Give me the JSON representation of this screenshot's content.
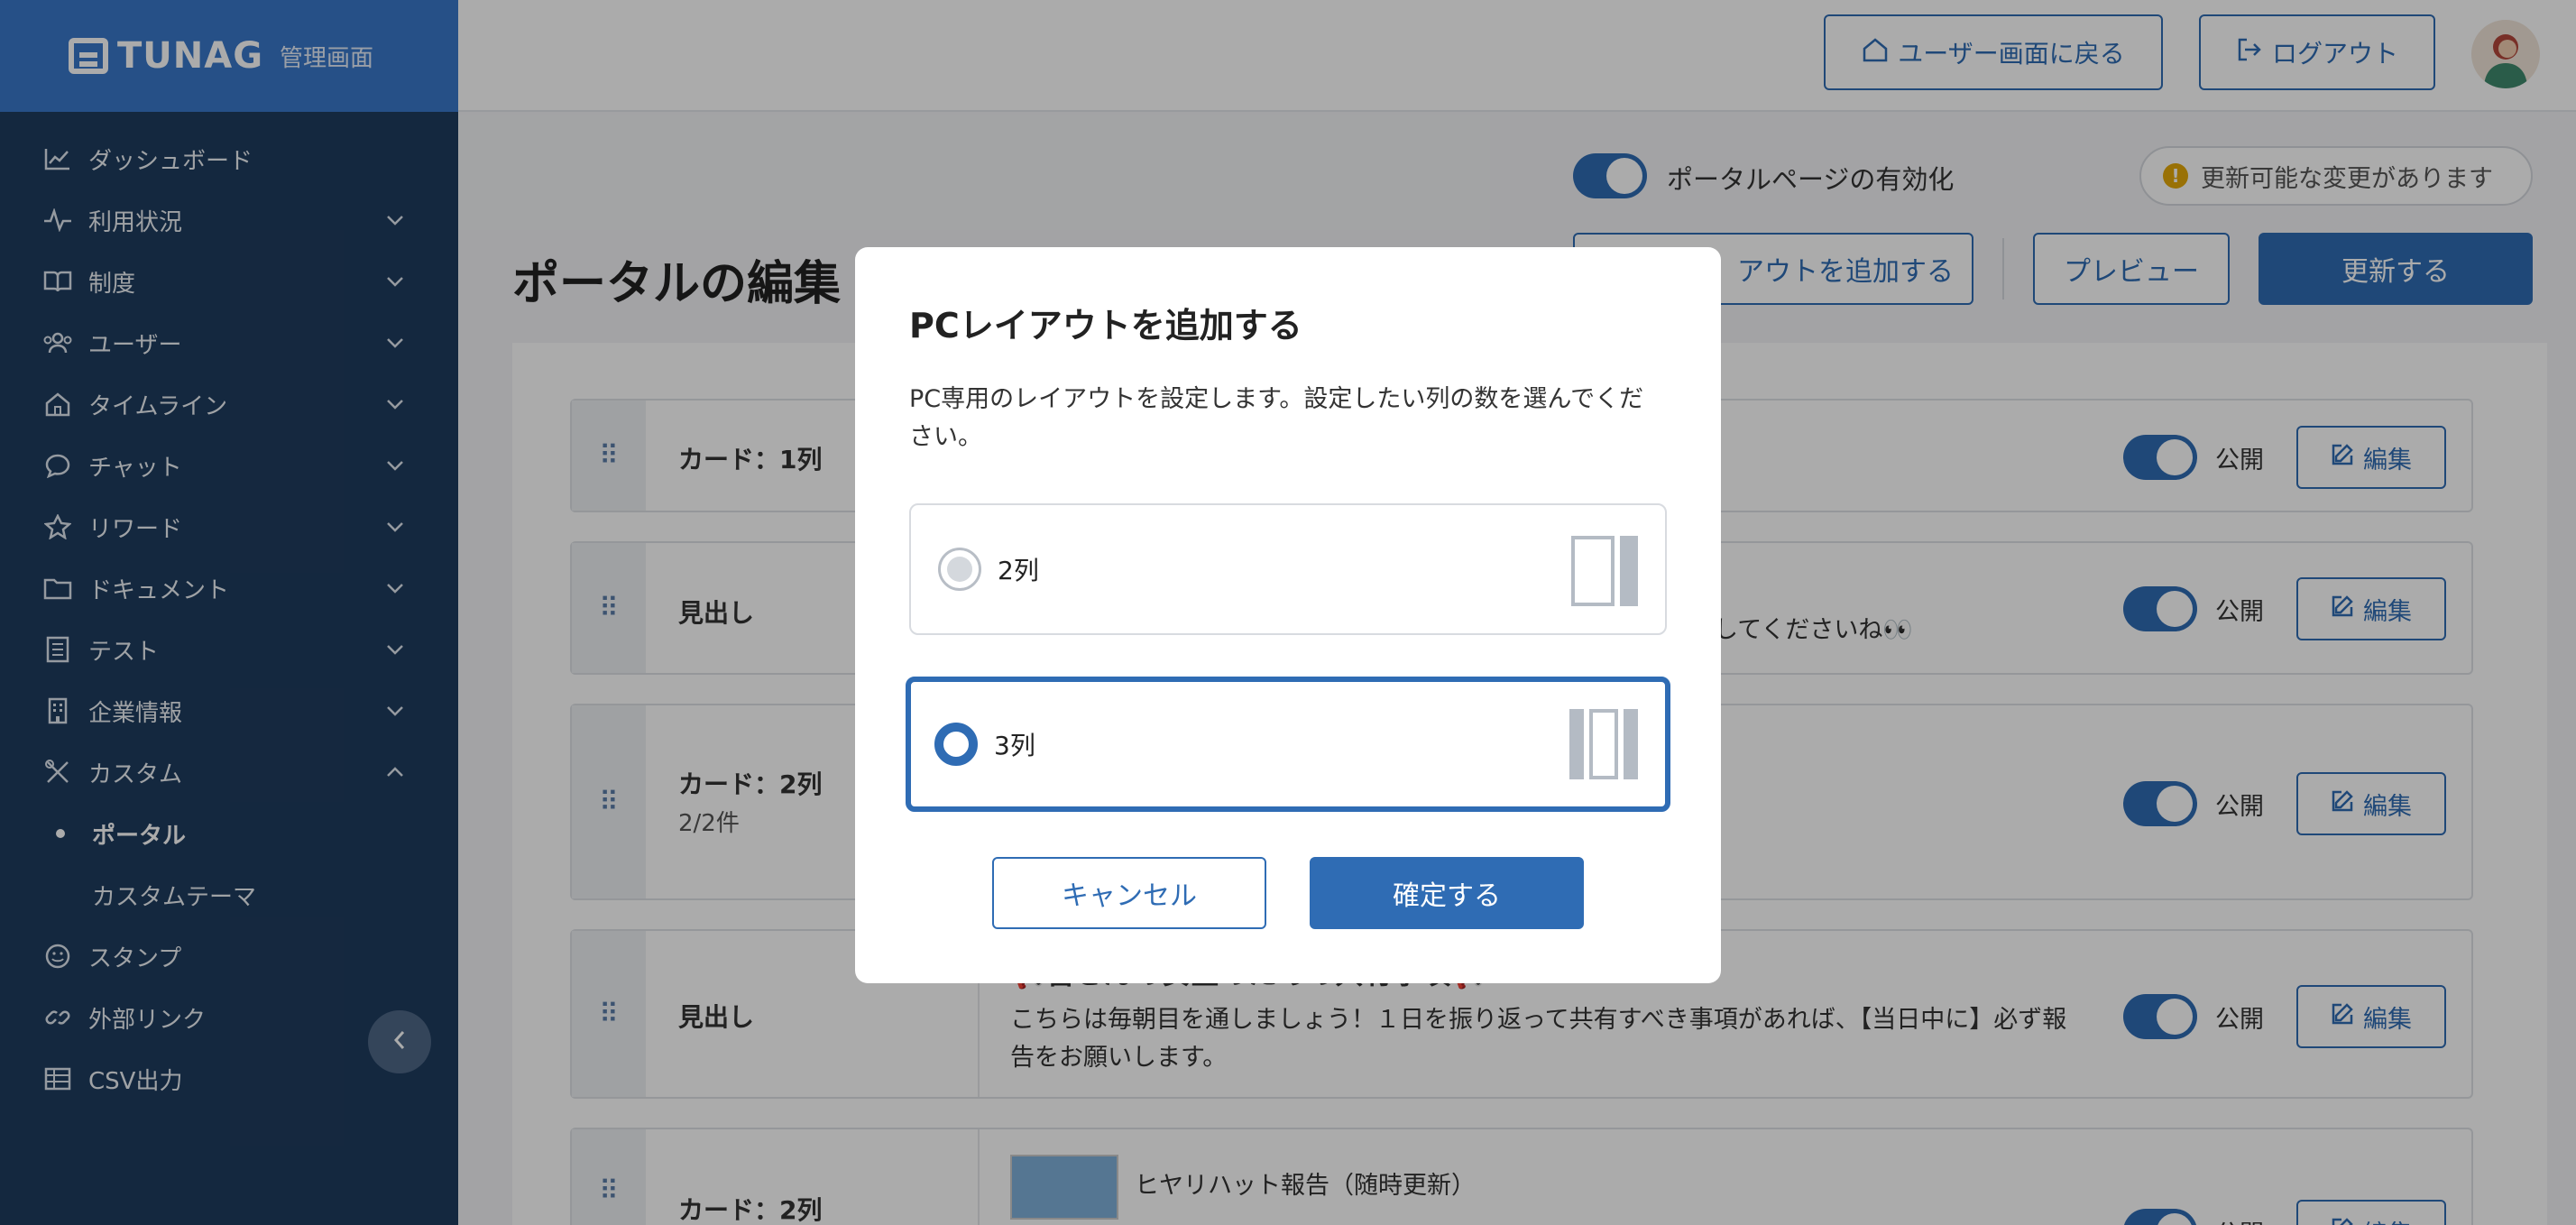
{
  "sidebar": {
    "logo_text": "TUNAG",
    "logo_sub": "管理画面",
    "items": [
      {
        "label": "ダッシュボード",
        "icon": "chart-icon"
      },
      {
        "label": "利用状況",
        "icon": "pulse-icon"
      },
      {
        "label": "制度",
        "icon": "book-icon"
      },
      {
        "label": "ユーザー",
        "icon": "users-icon"
      },
      {
        "label": "タイムライン",
        "icon": "home-icon"
      },
      {
        "label": "チャット",
        "icon": "chat-icon"
      },
      {
        "label": "リワード",
        "icon": "star-icon"
      },
      {
        "label": "ドキュメント",
        "icon": "folder-icon"
      },
      {
        "label": "テスト",
        "icon": "test-icon"
      },
      {
        "label": "企業情報",
        "icon": "building-icon"
      },
      {
        "label": "カスタム",
        "icon": "tools-icon"
      },
      {
        "label": "スタンプ",
        "icon": "smile-icon"
      },
      {
        "label": "外部リンク",
        "icon": "link-icon"
      },
      {
        "label": "CSV出力",
        "icon": "table-icon"
      }
    ],
    "custom_sub": [
      "ポータル",
      "カスタムテーマ"
    ]
  },
  "topbar": {
    "user_screen_btn": "ユーザー画面に戻る",
    "logout_btn": "ログアウト"
  },
  "main": {
    "portal_toggle_label": "ポータルページの有効化",
    "notice": "更新可能な変更があります",
    "page_title": "ポータルの編集",
    "add_layout_btn": "アウトを追加する",
    "preview_btn": "プレビュー",
    "update_btn": "更新する",
    "rows": [
      {
        "type": "カード：1列",
        "sub": "",
        "text": "",
        "public": "公開",
        "edit": "編集"
      },
      {
        "type": "見出し",
        "sub": "",
        "text": "してくださいね👀",
        "public": "公開",
        "edit": "編集"
      },
      {
        "type": "カード：2列",
        "sub": "2/2件",
        "text": "",
        "public": "公開",
        "edit": "編集"
      },
      {
        "type": "見出し",
        "sub": "",
        "text_title": "📢皆さんの安全のための共有事項📢",
        "text": "こちらは毎朝目を通しましょう！１日を振り返って共有すべき事項があれば、【当日中に】必ず報告をお願いします。",
        "public": "公開",
        "edit": "編集"
      },
      {
        "type": "カード：2列",
        "sub": "",
        "text": "ヒヤリハット報告（随時更新）",
        "public": "公開",
        "edit": "編集"
      }
    ]
  },
  "modal": {
    "title": "PCレイアウトを追加する",
    "description": "PC専用のレイアウトを設定します。設定したい列の数を選んでください。",
    "options": [
      {
        "label": "2列",
        "selected": false
      },
      {
        "label": "3列",
        "selected": true
      }
    ],
    "cancel": "キャンセル",
    "confirm": "確定する"
  },
  "colors": {
    "primary": "#2f6cb4",
    "sidebar": "#1f3c5e",
    "warning": "#e4a90a"
  }
}
